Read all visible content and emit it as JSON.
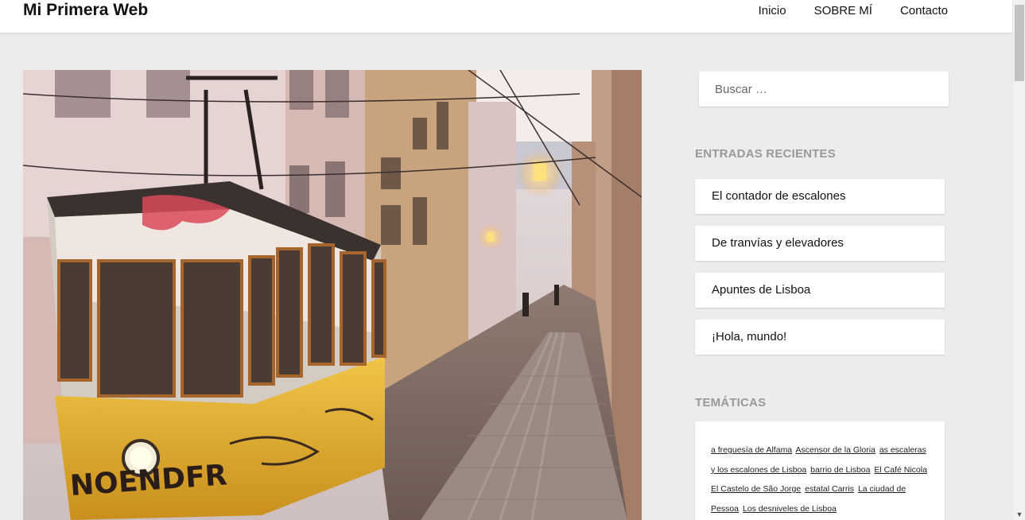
{
  "site": {
    "title": "Mi Primera Web"
  },
  "nav": {
    "items": [
      "Inicio",
      "SOBRE MÍ",
      "Contacto"
    ]
  },
  "sidebar": {
    "search": {
      "placeholder": "Buscar …"
    },
    "recent_title": "ENTRADAS RECIENTES",
    "recent_posts": [
      "El contador de escalones",
      "De tranvías y elevadores",
      "Apuntes de Lisboa",
      "¡Hola, mundo!"
    ],
    "topics_title": "TEMÁTICAS",
    "tags": [
      "a freguesía de Alfama",
      "Ascensor de la Gloria",
      "as escaleras y los escalones de Lisboa",
      "barrio de Lisboa",
      "El Café Nicola",
      "El Castelo de São Jorge",
      "estatal Carris",
      "La ciudad de Pessoa",
      "Los desniveles de Lisboa"
    ]
  },
  "hero": {
    "tram_graffiti": "NOENDFR"
  },
  "colors": {
    "background": "#ececec",
    "header": "#ffffff",
    "widget_title": "#999999",
    "tram_yellow": "#e7b62e"
  }
}
